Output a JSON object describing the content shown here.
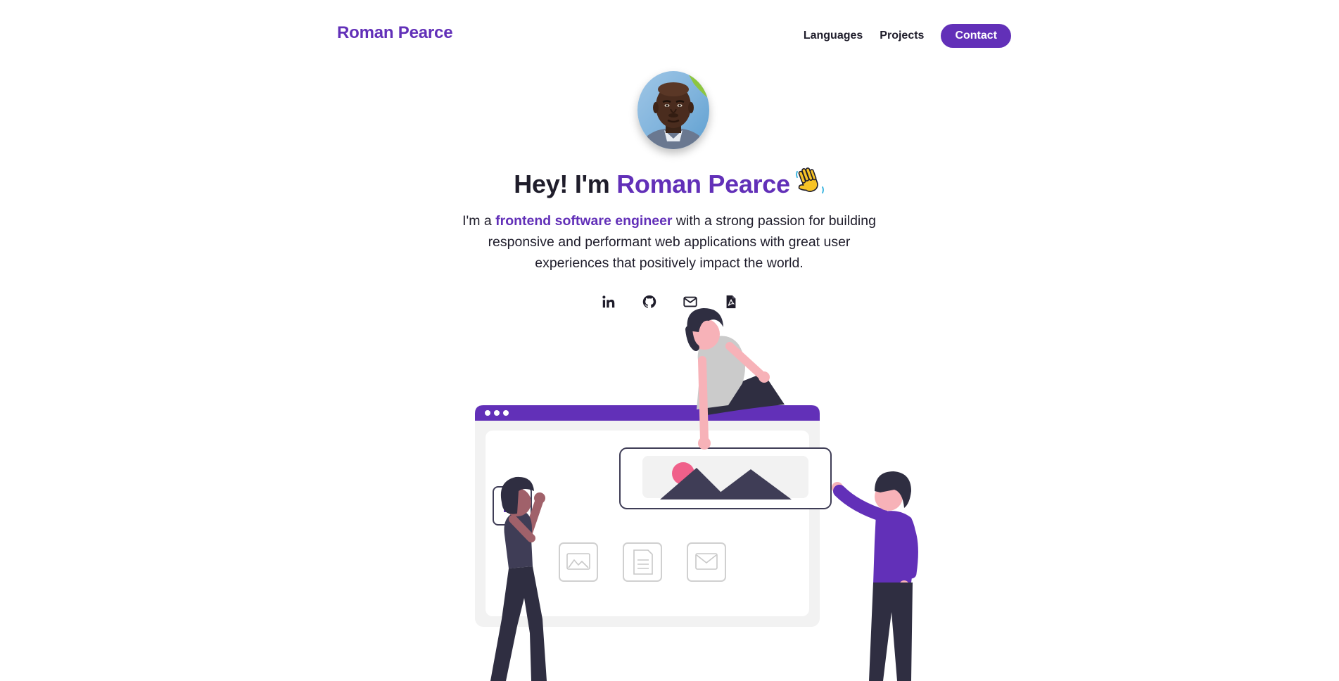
{
  "header": {
    "brand": "Roman Pearce",
    "nav": {
      "languages": "Languages",
      "projects": "Projects",
      "contact": "Contact"
    }
  },
  "hero": {
    "greeting": "Hey! I'm ",
    "name": "Roman Pearce",
    "bio_prefix": "I'm a ",
    "bio_highlight": "frontend software engineer",
    "bio_suffix": " with a strong passion for building responsive and performant web applications with great user experiences that positively impact the world."
  },
  "socials": [
    {
      "icon": "linkedin-icon"
    },
    {
      "icon": "github-icon"
    },
    {
      "icon": "mail-icon"
    },
    {
      "icon": "pdf-icon"
    }
  ],
  "colors": {
    "accent": "#6230b8",
    "text": "#1f1d2b",
    "background": "#ffffff"
  }
}
